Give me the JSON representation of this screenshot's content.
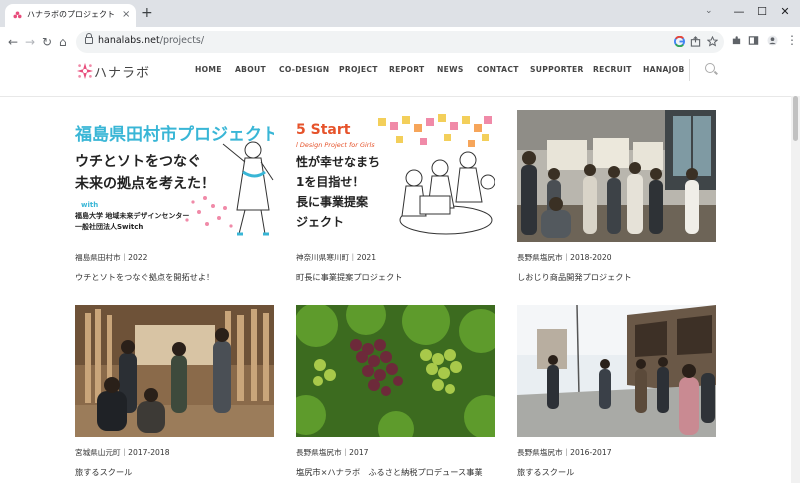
{
  "browser": {
    "tab_title": "ハナラボのプロジェクト | NPO法人ハナ",
    "tab_close": "×",
    "new_tab": "+",
    "url_host": "hanalabs.net",
    "url_path": "/projects/",
    "win_minimize": "—",
    "win_maximize": "☐",
    "win_close": "✕",
    "tab_search": "⌄",
    "nav_back": "←",
    "nav_forward": "→",
    "nav_reload": "↻",
    "nav_home": "⌂"
  },
  "site": {
    "logo_text": "ハナラボ",
    "menu": [
      "HOME",
      "ABOUT",
      "CO-DESIGN",
      "PROJECT",
      "REPORT",
      "NEWS",
      "CONTACT",
      "SUPPORTER",
      "RECRUIT",
      "HANAJOB"
    ]
  },
  "projects": [
    {
      "meta": "福島県田村市｜2022",
      "title": "ウチとソトをつなぐ拠点を開拓せよ！",
      "thumb": {
        "headline": "福島県田村市プロジェクト",
        "line1": "ウチとソトをつなぐ",
        "line2": "未来の拠点を考えた！",
        "with": "with",
        "org1": "福島大学 地域未来デザインセンター",
        "org2": "一般社団法人Switch"
      }
    },
    {
      "meta": "神奈川県寒川町｜2021",
      "title": "町長に事業提案プロジェクト",
      "thumb": {
        "start": "5 Start",
        "sub": "l Design Project for Girls",
        "line1": "性が幸せなまち",
        "line2": "1を目指せ！",
        "line3": "長に事業提案",
        "line4": "ジェクト"
      }
    },
    {
      "meta": "長野県塩尻市｜2018-2020",
      "title": "しおじり商品開発プロジェクト"
    },
    {
      "meta": "宮城県山元町｜2017-2018",
      "title": "旅するスクール"
    },
    {
      "meta": "長野県塩尻市｜2017",
      "title": "塩尻市×ハナラボ　ふるさと納税プロデュース事業"
    },
    {
      "meta": "長野県塩尻市｜2016-2017",
      "title": "旅するスクール"
    }
  ]
}
